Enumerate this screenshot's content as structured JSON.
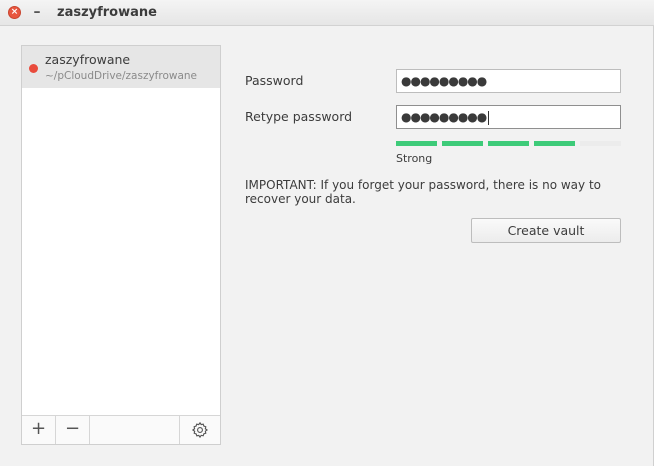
{
  "window": {
    "title": "zaszyfrowane",
    "close_glyph": "×",
    "minimize_glyph": "–"
  },
  "sidebar": {
    "vaults": [
      {
        "name": "zaszyfrowane",
        "path": "~/pCloudDrive/zaszyfrowane",
        "status_color": "#e94b3c"
      }
    ],
    "toolbar": {
      "add_glyph": "+",
      "remove_glyph": "−",
      "settings_icon": "gear-icon"
    }
  },
  "form": {
    "password_label": "Password",
    "password_value": "●●●●●●●●●",
    "retype_label": "Retype password",
    "retype_value": "●●●●●●●●●",
    "strength": {
      "label": "Strong",
      "filled_segments": 4,
      "total_segments": 5,
      "filled_color": "#3ecb79",
      "empty_color": "#ececec"
    },
    "important_text": "IMPORTANT: If you forget your password, there is no way to recover your data.",
    "create_button_label": "Create vault"
  }
}
